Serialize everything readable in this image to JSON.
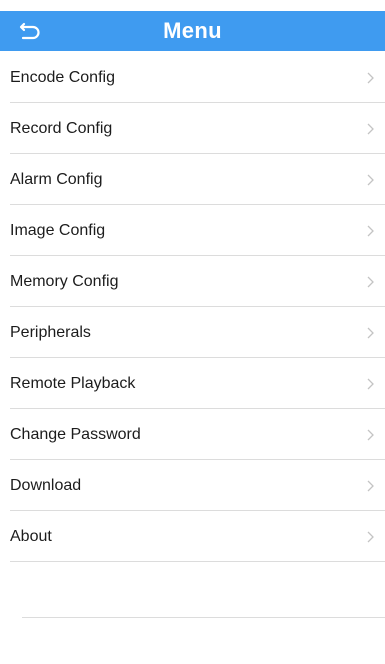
{
  "header": {
    "title": "Menu",
    "back_icon": "back-arrow-icon",
    "background_color": "#3f9bf0"
  },
  "menu": {
    "items": [
      {
        "label": "Encode Config"
      },
      {
        "label": "Record Config"
      },
      {
        "label": "Alarm Config"
      },
      {
        "label": "Image Config"
      },
      {
        "label": "Memory Config"
      },
      {
        "label": "Peripherals"
      },
      {
        "label": "Remote Playback"
      },
      {
        "label": "Change Password"
      },
      {
        "label": "Download"
      },
      {
        "label": "About"
      }
    ],
    "chevron_icon": "chevron-right-icon"
  }
}
